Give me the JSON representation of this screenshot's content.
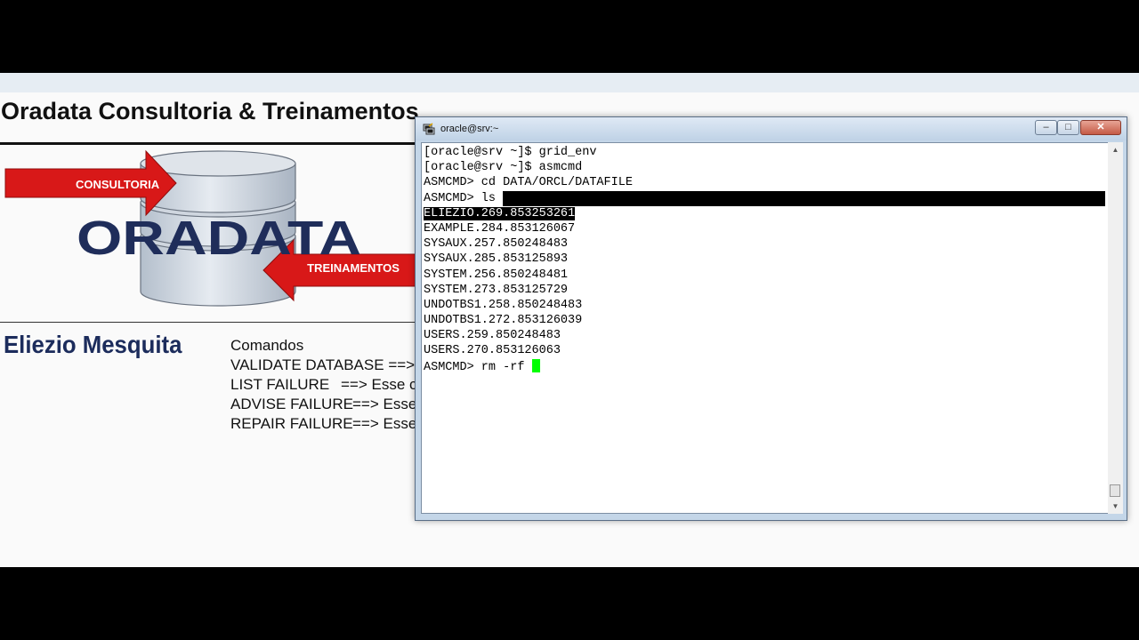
{
  "slide": {
    "title": "Oradata Consultoria & Treinamentos",
    "logo": {
      "name": "ORADATA",
      "tag_top": "CONSULTORIA",
      "tag_bottom": "TREINAMENTOS"
    },
    "author": "Eliezio Mesquita",
    "commands_heading": "Comandos",
    "commands": [
      {
        "name": "VALIDATE DATABASE",
        "desc": "==> Esse co"
      },
      {
        "name": "LIST FAILURE",
        "desc": "==> Esse co"
      },
      {
        "name": "ADVISE FAILURE",
        "desc": "==> Esse c"
      },
      {
        "name": "REPAIR FAILURE",
        "desc": "==> Esse c"
      }
    ]
  },
  "terminal": {
    "title": "oracle@srv:~",
    "lines": [
      "[oracle@srv ~]$ grid_env",
      "[oracle@srv ~]$ asmcmd",
      "ASMCMD> cd DATA/ORCL/DATAFILE",
      "ASMCMD> ls",
      "ELIEZIO.269.853253261",
      "EXAMPLE.284.853126067",
      "SYSAUX.257.850248483",
      "SYSAUX.285.853125893",
      "SYSTEM.256.850248481",
      "SYSTEM.273.853125729",
      "UNDOTBS1.258.850248483",
      "UNDOTBS1.272.853126039",
      "USERS.259.850248483",
      "USERS.270.853126063",
      "ASMCMD> rm -rf "
    ],
    "selected_line_index": 4
  },
  "colors": {
    "arrow_red": "#d81818",
    "logo_navy": "#1f2d5a",
    "cursor_green": "#00ff00",
    "titlebar_blue": "#c4d6e8"
  },
  "icons": {
    "terminal": "putty-icon",
    "minimize": "minimize-icon",
    "maximize": "maximize-icon",
    "close": "close-icon"
  }
}
